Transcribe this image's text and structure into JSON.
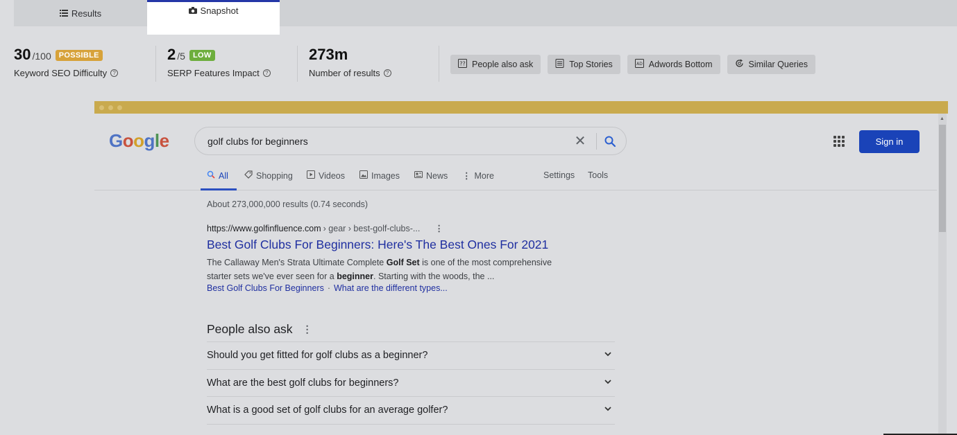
{
  "tabs": {
    "results_label": "Results",
    "snapshot_label": "Snapshot"
  },
  "stats": {
    "difficulty": {
      "value": "30",
      "max": "/100",
      "badge": "POSSIBLE",
      "label": "Keyword SEO Difficulty"
    },
    "serp": {
      "value": "2",
      "max": "/5",
      "badge": "LOW",
      "label": "SERP Features Impact"
    },
    "results": {
      "value": "273m",
      "label": "Number of results"
    }
  },
  "features": [
    {
      "label": "People also ask",
      "icon": "question-box-icon"
    },
    {
      "label": "Top Stories",
      "icon": "newspaper-icon"
    },
    {
      "label": "Adwords Bottom",
      "icon": "ad-icon"
    },
    {
      "label": "Similar Queries",
      "icon": "refresh-search-icon"
    }
  ],
  "google": {
    "query": "golf clubs for beginners",
    "signin_label": "Sign in",
    "nav": {
      "all": "All",
      "shopping": "Shopping",
      "videos": "Videos",
      "images": "Images",
      "news": "News",
      "more": "More",
      "settings": "Settings",
      "tools": "Tools"
    },
    "result_stats": "About 273,000,000 results (0.74 seconds)",
    "result": {
      "url_domain": "https://www.golfinfluence.com",
      "url_path": "› gear › best-golf-clubs-...",
      "title": "Best Golf Clubs For Beginners: Here's The Best Ones For 2021",
      "snippet_1a": "The Callaway Men's Strata Ultimate Complete ",
      "snippet_1b": "Golf Set",
      "snippet_1c": " is one of the most comprehensive",
      "snippet_2a": "starter sets we've ever seen for a ",
      "snippet_2b": "beginner",
      "snippet_2c": ". Starting with the woods, the ...",
      "sitelink_1": "Best Golf Clubs For Beginners",
      "sitelink_sep": "·",
      "sitelink_2": "What are the different types..."
    },
    "paa": {
      "title": "People also ask",
      "questions": [
        "Should you get fitted for golf clubs as a beginner?",
        "What are the best golf clubs for beginners?",
        "What is a good set of golf clubs for an average golfer?"
      ]
    }
  }
}
